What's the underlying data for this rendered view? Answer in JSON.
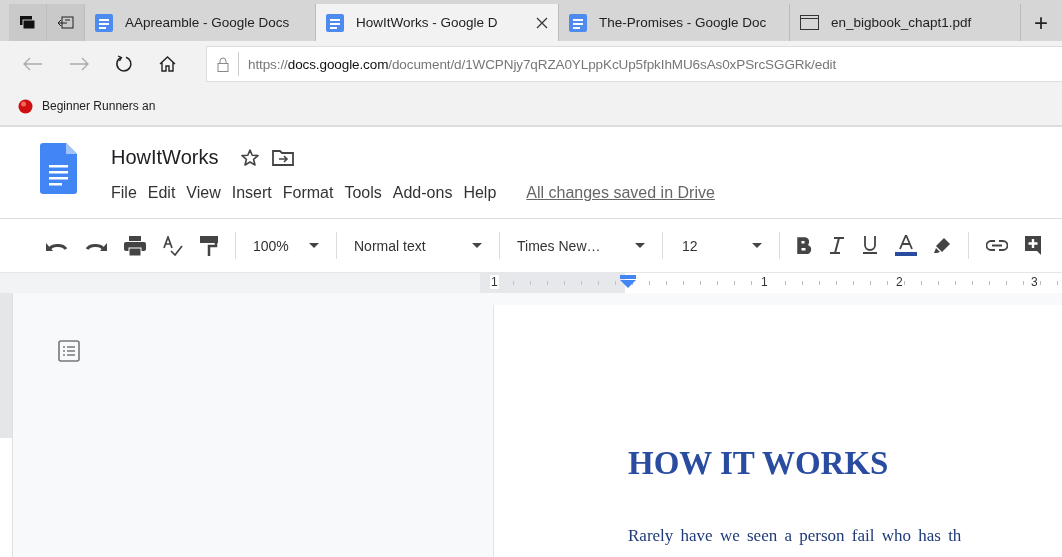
{
  "browser": {
    "tabs": [
      {
        "kind": "doc",
        "label": "AApreamble - Google Docs",
        "selected": false
      },
      {
        "kind": "doc",
        "label": "HowItWorks - Google D",
        "selected": true
      },
      {
        "kind": "doc",
        "label": "The-Promises - Google Doc",
        "selected": false
      },
      {
        "kind": "pdf",
        "label": "en_bigbook_chapt1.pdf",
        "selected": false
      }
    ],
    "new_tab": "+",
    "address": {
      "scheme": "https://",
      "host": "docs.google.com",
      "path": "/document/d/1WCPNjy7qRZA0YLppKcUp5fpkIhMU6sAs0xPSrcSGGRk/edit"
    },
    "favorites": [
      {
        "label": "Beginner Runners an"
      }
    ]
  },
  "docs": {
    "title": "HowItWorks",
    "starred": false,
    "menu": [
      "File",
      "Edit",
      "View",
      "Insert",
      "Format",
      "Tools",
      "Add-ons",
      "Help"
    ],
    "save_status": "All changes saved in Drive",
    "toolbar": {
      "zoom": "100%",
      "style": "Normal text",
      "font": "Times New…",
      "size": "12"
    },
    "ruler": [
      "1",
      "1",
      "2",
      "3"
    ],
    "document": {
      "heading": "HOW IT WORKS",
      "paragraph": "Rarely have we seen a person fail who has th"
    }
  }
}
